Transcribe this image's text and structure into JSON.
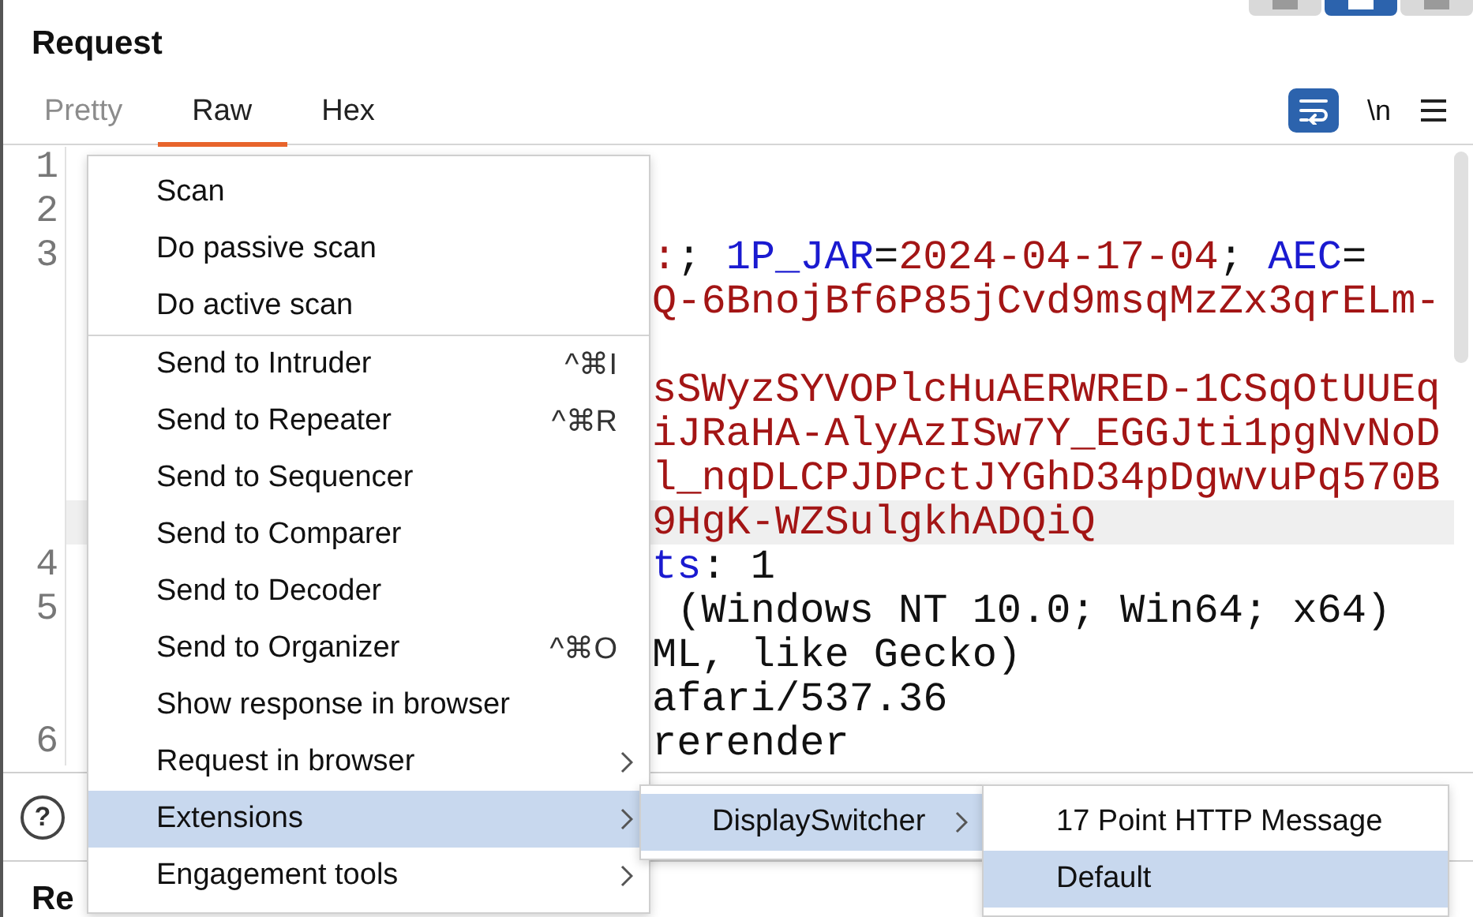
{
  "view_toggle": [
    {
      "selected": false
    },
    {
      "selected": true
    },
    {
      "selected": false
    }
  ],
  "panel_title": "Request",
  "tabs": [
    {
      "label": "Pretty",
      "selected": false,
      "disabled": true
    },
    {
      "label": "Raw",
      "selected": true,
      "disabled": false
    },
    {
      "label": "Hex",
      "selected": false,
      "disabled": false
    }
  ],
  "toolbar": {
    "wrap_on": true,
    "newline_label": "\\n"
  },
  "editor": {
    "rows": [
      {
        "number": "1",
        "highlighted": false
      },
      {
        "number": "2",
        "highlighted": false
      },
      {
        "number": "3",
        "highlighted": false,
        "segments": [
          {
            "text": ":",
            "kind": "value"
          },
          {
            "text": "; ",
            "kind": "plain"
          },
          {
            "text": "1P_JAR",
            "kind": "name"
          },
          {
            "text": "=",
            "kind": "plain"
          },
          {
            "text": "2024-04-17-04",
            "kind": "value"
          },
          {
            "text": "; ",
            "kind": "plain"
          },
          {
            "text": "AEC",
            "kind": "name"
          },
          {
            "text": "=",
            "kind": "plain"
          }
        ]
      },
      {
        "highlighted": false,
        "segments": [
          {
            "text": "Q-6BnojBf6P85jCvd9msqMzZx3qrELm-",
            "kind": "value"
          }
        ]
      },
      {
        "highlighted": false
      },
      {
        "highlighted": false,
        "segments": [
          {
            "text": "sSWyzSYVOPlcHuAERWRED-1CSqOtUUEq",
            "kind": "value"
          }
        ]
      },
      {
        "highlighted": false,
        "segments": [
          {
            "text": "iJRaHA-AlyAzISw7Y_EGGJti1pgNvNoD",
            "kind": "value"
          }
        ]
      },
      {
        "highlighted": false,
        "segments": [
          {
            "text": "l_nqDLCPJDPctJYGhD34pDgwvuPq570B",
            "kind": "value"
          }
        ]
      },
      {
        "highlighted": true,
        "segments": [
          {
            "text": "9HgK-WZSulgkhADQiQ",
            "kind": "value"
          }
        ]
      },
      {
        "number": "4",
        "highlighted": false,
        "segments": [
          {
            "text": "ts",
            "kind": "name"
          },
          {
            "text": ": 1",
            "kind": "plain"
          }
        ]
      },
      {
        "number": "5",
        "highlighted": false,
        "segments": [
          {
            "text": " (Windows NT 10.0; Win64; x64)",
            "kind": "plain"
          }
        ]
      },
      {
        "highlighted": false,
        "segments": [
          {
            "text": "ML, like Gecko)",
            "kind": "plain"
          }
        ]
      },
      {
        "highlighted": false,
        "segments": [
          {
            "text": "afari/537.36",
            "kind": "plain"
          }
        ]
      },
      {
        "number": "6",
        "highlighted": false,
        "segments": [
          {
            "text": "rerender",
            "kind": "plain"
          }
        ]
      }
    ]
  },
  "help_button": {
    "glyph": "?"
  },
  "bottom_heading": "Re",
  "context_menu": {
    "items": [
      {
        "kind": "item",
        "label": "Scan",
        "submenu": false,
        "selected": false
      },
      {
        "kind": "item",
        "label": "Do passive scan",
        "submenu": false,
        "selected": false
      },
      {
        "kind": "item",
        "label": "Do active scan",
        "submenu": false,
        "selected": false
      },
      {
        "kind": "separator"
      },
      {
        "kind": "item",
        "label": "Send to Intruder",
        "shortcut": "^⌘I",
        "submenu": false,
        "selected": false
      },
      {
        "kind": "item",
        "label": "Send to Repeater",
        "shortcut": "^⌘R",
        "submenu": false,
        "selected": false
      },
      {
        "kind": "item",
        "label": "Send to Sequencer",
        "submenu": false,
        "selected": false
      },
      {
        "kind": "item",
        "label": "Send to Comparer",
        "submenu": false,
        "selected": false
      },
      {
        "kind": "item",
        "label": "Send to Decoder",
        "submenu": false,
        "selected": false
      },
      {
        "kind": "item",
        "label": "Send to Organizer",
        "shortcut": "^⌘O",
        "submenu": false,
        "selected": false
      },
      {
        "kind": "item",
        "label": "Show response in browser",
        "submenu": false,
        "selected": false
      },
      {
        "kind": "item",
        "label": "Request in browser",
        "submenu": true,
        "selected": false
      },
      {
        "kind": "item",
        "label": "Extensions",
        "submenu": true,
        "selected": true
      },
      {
        "kind": "item",
        "label": "Engagement tools",
        "submenu": true,
        "selected": false
      }
    ]
  },
  "submenus": [
    {
      "items": [
        {
          "kind": "item",
          "label": "DisplaySwitcher",
          "submenu": true,
          "selected": true
        }
      ]
    },
    {
      "items": [
        {
          "kind": "item",
          "label": "17 Point HTTP Message",
          "submenu": false,
          "selected": false
        },
        {
          "kind": "item",
          "label": "Default",
          "submenu": false,
          "selected": true
        }
      ]
    }
  ]
}
